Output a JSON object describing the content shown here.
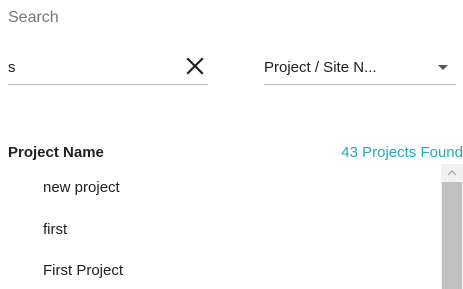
{
  "search": {
    "label": "Search",
    "value": "s",
    "clear_icon": "close-icon"
  },
  "filter": {
    "selected": "Project / Site N...",
    "arrow_icon": "caret-down-icon"
  },
  "list": {
    "header": "Project Name",
    "count": "43 Projects Found",
    "items": [
      "new project",
      "first",
      "First Project"
    ]
  },
  "colors": {
    "accent": "#26a9b4",
    "muted": "#777777"
  }
}
